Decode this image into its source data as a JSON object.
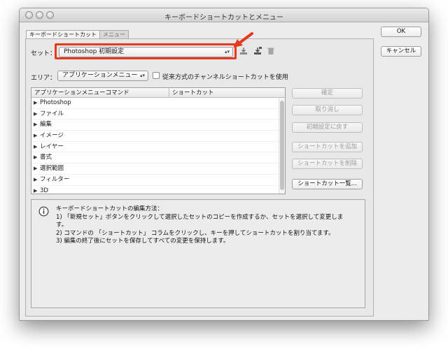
{
  "window": {
    "title": "キーボードショートカットとメニュー"
  },
  "tabs": [
    {
      "label": "キーボードショートカット",
      "active": true
    },
    {
      "label": "メニュー",
      "active": false
    }
  ],
  "set": {
    "label": "セット：",
    "value": "Photoshop 初期設定",
    "icons": [
      "save-set-icon",
      "save-set-as-icon",
      "delete-set-icon"
    ],
    "highlight_color": "#e63a1e"
  },
  "area": {
    "label": "エリア：",
    "value": "アプリケーションメニュー",
    "legacy_checkbox_label": "従来方式のチャンネルショートカットを使用",
    "legacy_checked": false
  },
  "table": {
    "columns": [
      "アプリケーションメニューコマンド",
      "ショートカット"
    ],
    "rows": [
      "Photoshop",
      "ファイル",
      "編集",
      "イメージ",
      "レイヤー",
      "書式",
      "選択範囲",
      "フィルター",
      "3D"
    ]
  },
  "side_buttons": [
    {
      "label": "確定",
      "enabled": false
    },
    {
      "label": "取り消し",
      "enabled": false
    },
    {
      "label": "初期設定に戻す",
      "enabled": false
    },
    {
      "label": "ショートカットを追加",
      "enabled": false
    },
    {
      "label": "ショートカットを削除",
      "enabled": false
    },
    {
      "label": "ショートカット一覧...",
      "enabled": true
    }
  ],
  "dialog_buttons": {
    "ok": "OK",
    "cancel": "キャンセル"
  },
  "info": {
    "heading": "キーボードショートカットの編集方法：",
    "lines": [
      "1) 「新規セット」ボタンをクリックして選択したセットのコピーを作成するか、セットを選択して変更しま",
      "す。",
      "2) コマンドの 「ショートカット」 コラムをクリックし、キーを押してショートカットを割り当てます。",
      "3) 編集の終了後にセットを保存してすべての変更を保持します。"
    ]
  }
}
